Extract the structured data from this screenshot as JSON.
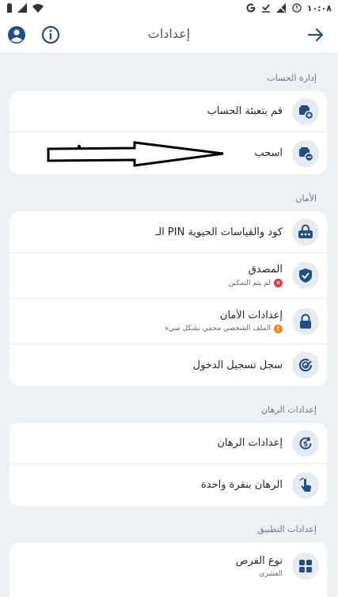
{
  "status_bar": {
    "time": "١٠:٠٨",
    "left_icons": [
      "battery-icon",
      "signal-icon",
      "wifi-icon"
    ],
    "right_icons": [
      "google-icon",
      "download-check-icon",
      "no-signal-icon",
      "alert-icon"
    ]
  },
  "header": {
    "title": "إعدادات"
  },
  "sections": {
    "account": {
      "title": "إدارة الحساب",
      "items": [
        {
          "label": "قم بتعبئة الحساب",
          "icon": "wallet-plus-icon"
        },
        {
          "label": "اسحب",
          "icon": "wallet-minus-icon"
        }
      ]
    },
    "security": {
      "title": "الأمان",
      "items": [
        {
          "label": "كود والقياسات الحيوية PIN الـ",
          "icon": "pin-code-icon"
        },
        {
          "label": "المصدق",
          "sub": "لم يتم التمكين",
          "icon": "shield-check-icon"
        },
        {
          "label": "إعدادات الأمان",
          "sub": "الملف الشخصي محمي بشكل سيء",
          "icon": "lock-icon"
        },
        {
          "label": "سجل تسجيل الدخول",
          "icon": "login-history-icon"
        }
      ]
    },
    "betting": {
      "title": "إعدادات الرهان",
      "items": [
        {
          "label": "إعدادات الرهان",
          "icon": "bet-settings-icon"
        },
        {
          "label": "الرهان بنقرة واحدة",
          "icon": "one-click-icon"
        }
      ]
    },
    "app": {
      "title": "إعدادات التطبيق",
      "items": [
        {
          "label": "نوع الفرص",
          "sub": "العشري",
          "icon": "grid-icon"
        }
      ]
    }
  },
  "colors": {
    "accent": "#1e4e8c",
    "icon_bg": "#e6ebf2",
    "page_bg": "#eef1f4"
  }
}
